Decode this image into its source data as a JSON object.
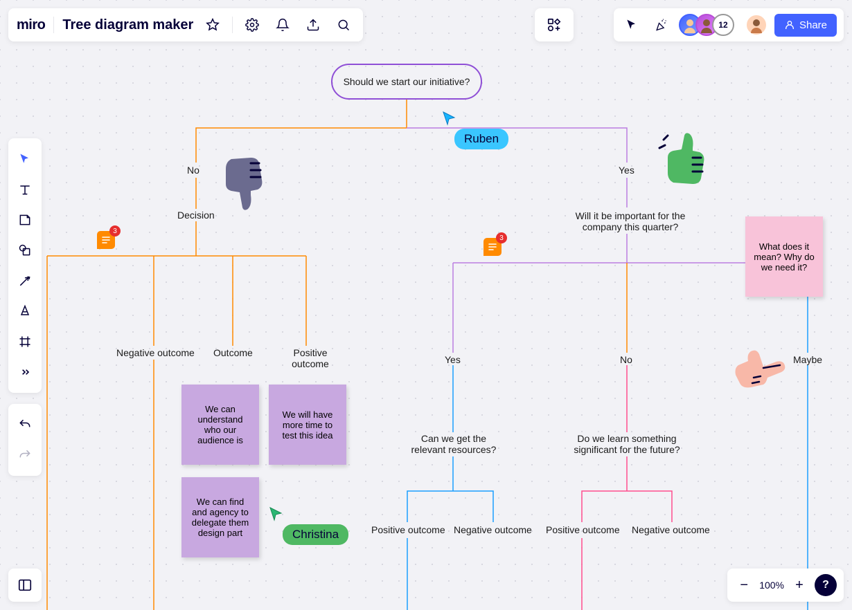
{
  "header": {
    "logo": "miro",
    "board_title": "Tree diagram maker",
    "avatar_count": "12"
  },
  "share": {
    "label": "Share"
  },
  "cursors": {
    "ruben": "Ruben",
    "christina": "Christina"
  },
  "comments": {
    "c1": "3",
    "c2": "3"
  },
  "nodes": {
    "root": "Should we start our initiative?",
    "no": "No",
    "yes": "Yes",
    "decision": "Decision",
    "important": "Will it be important for the company this quarter?",
    "neg_outcome": "Negative outcome",
    "outcome": "Outcome",
    "pos_outcome": "Positive outcome",
    "yes2": "Yes",
    "no2": "No",
    "maybe": "Maybe",
    "resources": "Can we get the relevant resources?",
    "learn": "Do we learn something significant for the future?",
    "pos_outcome2": "Positive outcome",
    "neg_outcome2": "Negative outcome",
    "pos_outcome3": "Positive outcome",
    "neg_outcome3": "Negative outcome"
  },
  "stickies": {
    "audience": "We can understand who our audience is",
    "time": "We will have more time to test this idea",
    "agency": "We can find and agency to delegate them design part",
    "meaning": "What does it mean? Why do we need it?"
  },
  "zoom": {
    "level": "100%"
  }
}
